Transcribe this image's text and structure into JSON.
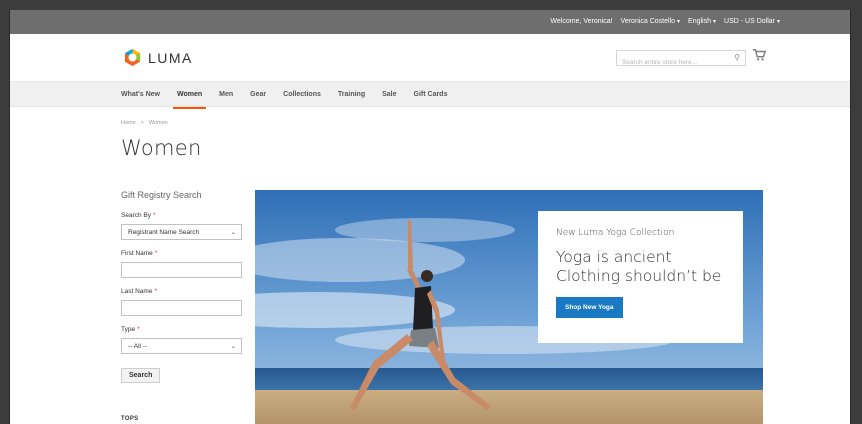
{
  "topbar": {
    "welcome": "Welcome, Veronica!",
    "account": "Veronica Costello",
    "language": "English",
    "currency": "USD - US Dollar"
  },
  "header": {
    "logo_text": "LUMA",
    "search_placeholder": "Search entire store here...",
    "logo_colors": [
      "#f26322",
      "#00a9e0",
      "#8cc63f",
      "#ffb400"
    ]
  },
  "nav": {
    "items": [
      "What's New",
      "Women",
      "Men",
      "Gear",
      "Collections",
      "Training",
      "Sale",
      "Gift Cards"
    ],
    "active": "Women"
  },
  "breadcrumb": {
    "home": "Home",
    "separator": ">",
    "current": "Women"
  },
  "page_title": "Women",
  "sidebar": {
    "title": "Gift Registry Search",
    "search_by_label": "Search By",
    "search_by_value": "Registrant Name Search",
    "first_name_label": "First Name",
    "last_name_label": "Last Name",
    "type_label": "Type",
    "type_value": "-- All --",
    "required_mark": "*",
    "search_button": "Search",
    "tops_heading": "TOPS"
  },
  "hero": {
    "subtitle": "New Luma Yoga Collection",
    "headline_line1": "Yoga is ancient",
    "headline_line2": "Clothing shouldn’t be",
    "button": "Shop New Yoga",
    "button_color": "#1979c3"
  },
  "colors": {
    "accent": "#ff5501",
    "topbar_bg": "#6e6e6e",
    "nav_bg": "#f0f0f0"
  }
}
